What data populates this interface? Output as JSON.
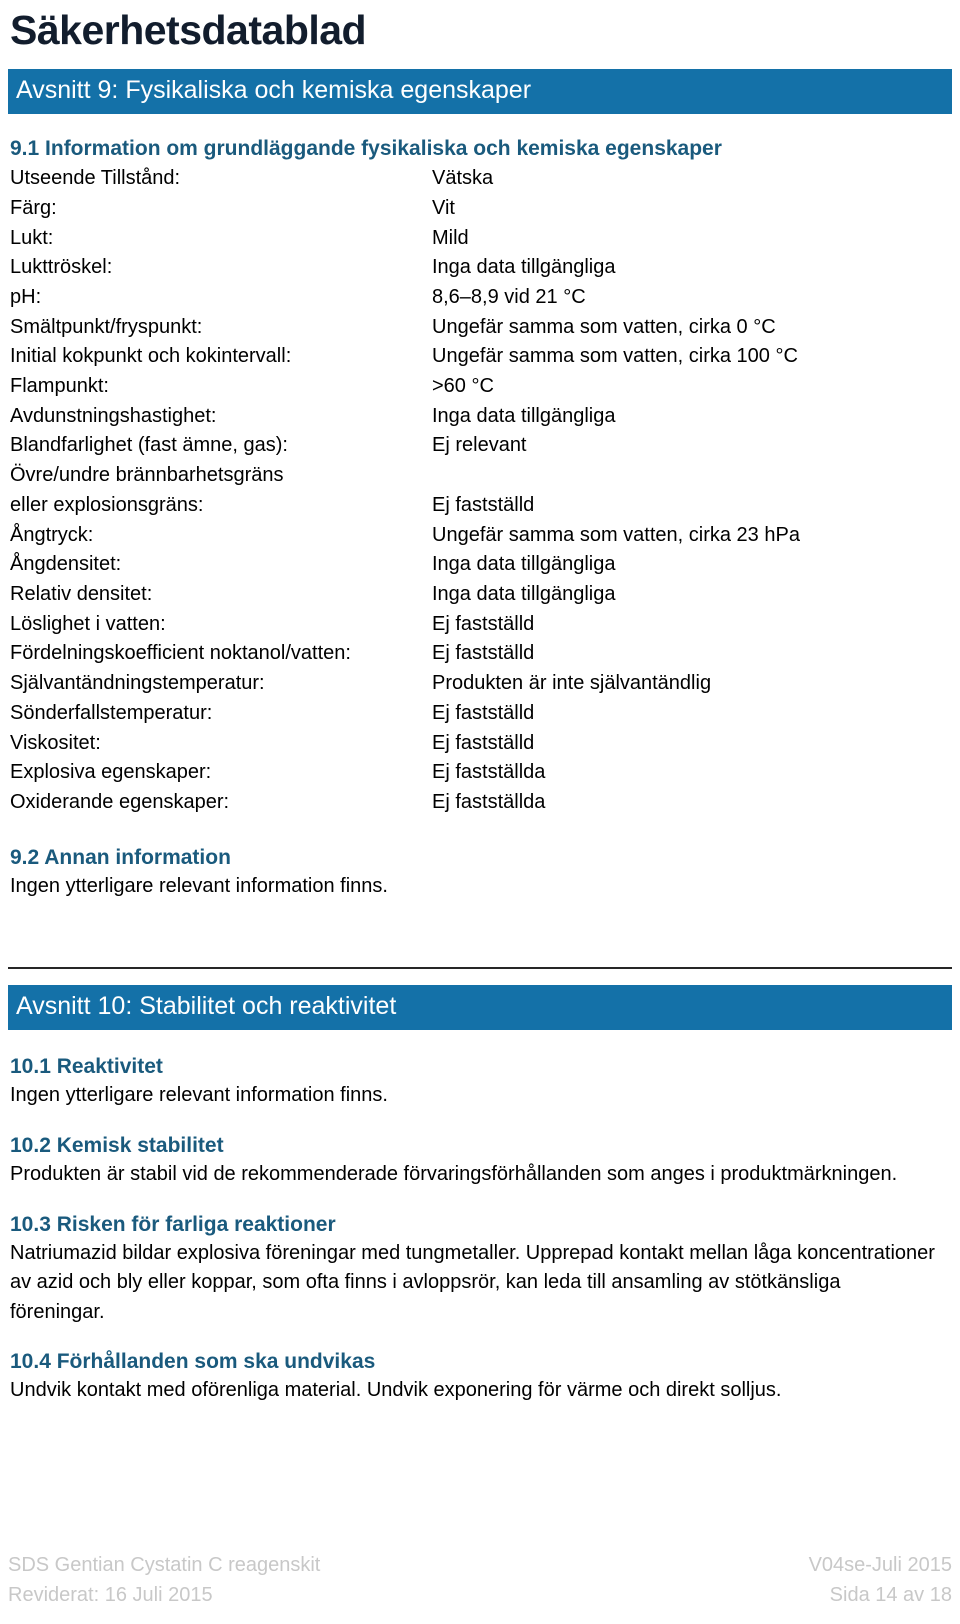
{
  "document": {
    "title": "Säkerhetsdatablad"
  },
  "colors": {
    "banner_blue": "#1471a8",
    "heading_blue": "#1a5a7d",
    "title_navy": "#121d2d",
    "footer_gray": "#c8c8c8",
    "rule_dark": "#262626"
  },
  "section9": {
    "banner": "Avsnitt 9: Fysikaliska och kemiska egenskaper",
    "sub1_heading": "9.1 Information om grundläggande fysikaliska och kemiska egenskaper",
    "properties": [
      {
        "label": "Utseende Tillstånd:",
        "value": "Vätska"
      },
      {
        "label": "Färg:",
        "value": "Vit"
      },
      {
        "label": "Lukt:",
        "value": "Mild"
      },
      {
        "label": "Lukttröskel:",
        "value": "Inga data tillgängliga"
      },
      {
        "label": "pH:",
        "value": "8,6–8,9 vid 21 °C"
      },
      {
        "label": "Smältpunkt/fryspunkt:",
        "value": "Ungefär samma som vatten, cirka 0 °C"
      },
      {
        "label": "Initial kokpunkt och kokintervall:",
        "value": "Ungefär samma som vatten, cirka 100 °C"
      },
      {
        "label": "Flampunkt:",
        "value": ">60 °C"
      },
      {
        "label": "Avdunstningshastighet:",
        "value": "Inga data tillgängliga"
      },
      {
        "label": "Blandfarlighet (fast ämne, gas):",
        "value": "Ej relevant"
      },
      {
        "label": "Övre/undre brännbarhetsgräns",
        "value": ""
      },
      {
        "label": "eller explosionsgräns:",
        "value": "Ej fastställd"
      },
      {
        "label": "Ångtryck:",
        "value": "Ungefär samma som vatten, cirka 23 hPa"
      },
      {
        "label": "Ångdensitet:",
        "value": "Inga data tillgängliga"
      },
      {
        "label": "Relativ densitet:",
        "value": "Inga data tillgängliga"
      },
      {
        "label": "Löslighet i vatten:",
        "value": "Ej fastställd"
      },
      {
        "label": "Fördelningskoefficient noktanol/vatten:",
        "value": "Ej fastställd"
      },
      {
        "label": "Självantändningstemperatur:",
        "value": "Produkten är inte självantändlig"
      },
      {
        "label": "Sönderfallstemperatur:",
        "value": "Ej fastställd"
      },
      {
        "label": "Viskositet:",
        "value": "Ej fastställd"
      },
      {
        "label": "Explosiva egenskaper:",
        "value": "Ej fastställda"
      },
      {
        "label": "Oxiderande egenskaper:",
        "value": "Ej fastställda"
      }
    ],
    "sub2_heading": "9.2 Annan information",
    "sub2_body": "Ingen ytterligare relevant information finns."
  },
  "section10": {
    "banner": "Avsnitt 10: Stabilitet och reaktivitet",
    "sub1_heading": "10.1 Reaktivitet",
    "sub1_body": "Ingen ytterligare relevant information finns.",
    "sub2_heading": "10.2 Kemisk stabilitet",
    "sub2_body": "Produkten är stabil vid de rekommenderade förvaringsförhållanden som anges i produktmärkningen.",
    "sub3_heading": "10.3 Risken för farliga reaktioner",
    "sub3_body": "Natriumazid bildar explosiva föreningar med tungmetaller. Upprepad kontakt mellan låga koncentrationer av azid och bly eller koppar, som ofta finns i avloppsrör, kan leda till ansamling av stötkänsliga föreningar.",
    "sub4_heading": "10.4 Förhållanden som ska undvikas",
    "sub4_body": "Undvik kontakt med oförenliga material. Undvik exponering för värme och direkt solljus."
  },
  "footer": {
    "product": "SDS Gentian Cystatin C reagenskit",
    "revised": "Reviderat: 16 Juli 2015",
    "version": "V04se-Juli 2015",
    "page": "Sida 14 av 18"
  }
}
